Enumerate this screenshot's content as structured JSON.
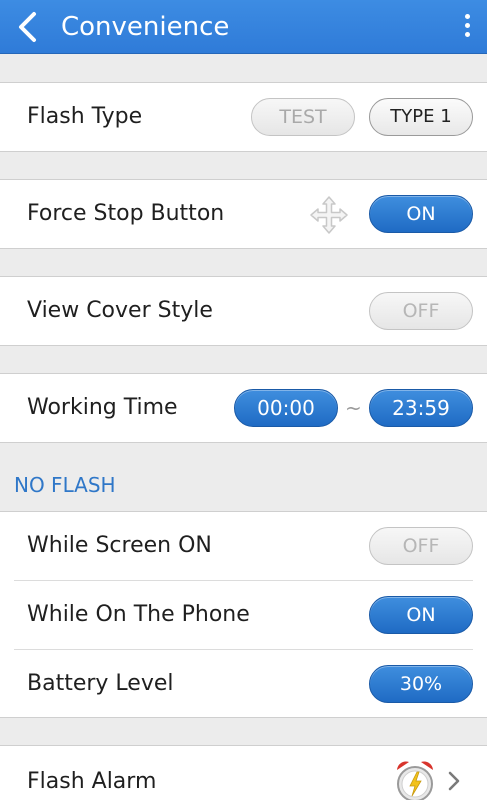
{
  "header": {
    "title": "Convenience",
    "back_icon": "chevron-left-icon",
    "menu_icon": "overflow-menu-icon"
  },
  "settings": {
    "flash_type": {
      "label": "Flash Type",
      "test_button": "TEST",
      "type_button": "TYPE 1"
    },
    "force_stop_button": {
      "label": "Force Stop Button",
      "icon": "move-arrows-icon",
      "value": "ON"
    },
    "view_cover_style": {
      "label": "View Cover Style",
      "value": "OFF"
    },
    "working_time": {
      "label": "Working Time",
      "start": "00:00",
      "separator": "~",
      "end": "23:59"
    }
  },
  "no_flash": {
    "section_title": "NO FLASH",
    "while_screen_on": {
      "label": "While Screen ON",
      "value": "OFF"
    },
    "while_on_the_phone": {
      "label": "While On The Phone",
      "value": "ON"
    },
    "battery_level": {
      "label": "Battery Level",
      "value": "30%"
    }
  },
  "flash_alarm": {
    "label": "Flash Alarm",
    "icon": "alarm-clock-icon",
    "chevron": "chevron-right-icon"
  },
  "colors": {
    "header_blue": "#3584dd",
    "section_blue": "#2f77c8",
    "on_blue": "#1f6bc4",
    "background": "#ececec"
  }
}
